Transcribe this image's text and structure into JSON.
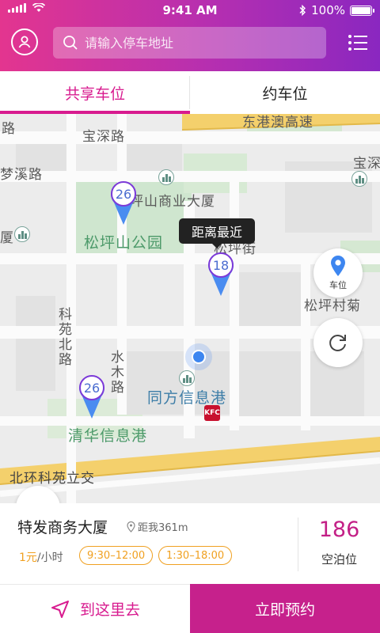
{
  "status_bar": {
    "time": "9:41 AM",
    "battery": "100%"
  },
  "header": {
    "search_placeholder": "请输入停车地址"
  },
  "tabs": [
    {
      "label": "共享车位"
    },
    {
      "label": "约车位"
    }
  ],
  "map": {
    "labels": {
      "baoshen_road": "宝深路",
      "road_fragment_top_left": "路",
      "dongguan_expressway": "东港澳高速",
      "mengxi_road": "梦溪路",
      "baoshen_fragment_right": "宝深",
      "songping_commerce": "坪山商业大厦",
      "songping_park": "松坪山公园",
      "edge_building": "厦",
      "songping_street": "松坪街",
      "songping_village": "松坪村菊",
      "kezhan_north_road": "科苑北路",
      "shuimu_road": "水木路",
      "tongfang_info": "同方信息港",
      "qinghua_info": "清华信息港",
      "beihuan_kezhan": "北环科苑立交"
    },
    "pins": [
      {
        "count": "26"
      },
      {
        "count": "18"
      },
      {
        "count": "26"
      }
    ],
    "tooltip": "距离最近",
    "parking_button_label": "车位",
    "colors": {
      "pin": "#4a8cf0",
      "pin_ring": "#7c3ad8",
      "road_yellow": "#f4d06c"
    }
  },
  "card": {
    "name": "特发商务大厦",
    "distance": "距我361m",
    "price_amount": "1元",
    "price_unit": "/小时",
    "slots": [
      "9:30–12:00",
      "1:30–18:00"
    ],
    "spots_count": "186",
    "spots_label": "空泊位"
  },
  "bottom": {
    "navigate_label": "到这里去",
    "book_label": "立即预约"
  },
  "colors": {
    "primary": "#d81b8f",
    "accent_orange": "#f0a020"
  }
}
